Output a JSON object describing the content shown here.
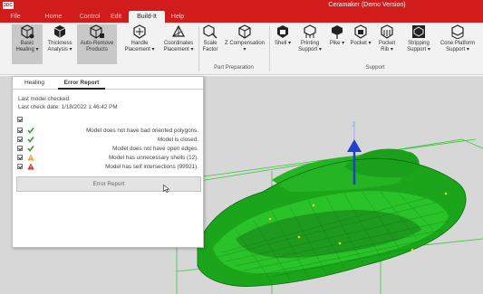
{
  "window": {
    "title": "Ceramaker (Demo Version)",
    "logo_text": "3DC"
  },
  "ribbon_tabs": [
    {
      "label": "File"
    },
    {
      "label": "Home"
    },
    {
      "label": "Control"
    },
    {
      "label": "Edit"
    },
    {
      "label": "Build-It"
    },
    {
      "label": "Help"
    }
  ],
  "ribbon": {
    "buttons": {
      "basic_healing": "Basic Healing ▾",
      "thickness_analysis": "Thickness Analysis ▾",
      "auto_remove_products": "Auto-Remove Products",
      "handle_placement": "Handle Placement ▾",
      "coordinates_placement": "Coordinates Placement ▾",
      "scale_factor": "Scale Factor",
      "z_compensation": "Z Compensation ▾",
      "shell": "Shell ▾",
      "printing_support": "Printing Support ▾",
      "pike": "Pike ▾",
      "pocket": "Pocket ▾",
      "pocket_rib": "Pocket Rib ▾",
      "stripping_support": "Stripping Support ▾",
      "cone_platform_support": "Cone Platform Support ▾"
    },
    "groups": {
      "part_preparation": "Part Preparation",
      "support": "Support"
    }
  },
  "dialog": {
    "tabs": [
      {
        "label": "Healing"
      },
      {
        "label": "Error Report"
      }
    ],
    "last_checked": "Last model checked:",
    "last_check_date": "Last check date: 1/18/2022 1:46:42 PM",
    "checks": [
      {
        "text": "Model does not have bad oriented polygons.",
        "status": "ok"
      },
      {
        "text": "Model is closed.",
        "status": "ok"
      },
      {
        "text": "Model does not have open edges.",
        "status": "ok"
      },
      {
        "text": "Model has unnecessary shells (12).",
        "status": "warning"
      },
      {
        "text": "Model has self intersections (99921).",
        "status": "error"
      }
    ],
    "error_report_button": "Error Report"
  },
  "viewport": {
    "axis_label": "Z"
  },
  "colors": {
    "title_bar": "#d21c1c",
    "ok": "#2e9e2e",
    "warning": "#f0a020",
    "error": "#d9261c",
    "model_green": "#1db31d",
    "axis_blue": "#2040d0"
  }
}
